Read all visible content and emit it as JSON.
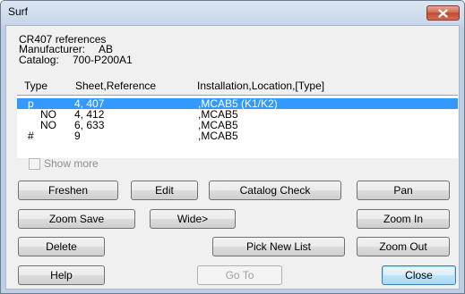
{
  "window": {
    "title": "Surf"
  },
  "info": {
    "references": "CR407 references",
    "manufacturer_label": "Manufacturer:",
    "manufacturer_value": "AB",
    "catalog_label": "Catalog:",
    "catalog_value": "700-P200A1"
  },
  "list": {
    "columns": [
      "Type",
      "Sheet,Reference",
      "Installation,Location,[Type]"
    ],
    "rows": [
      {
        "type": "p",
        "ref": "4, 407",
        "loc": ",MCAB5 (K1/K2)",
        "selected": true
      },
      {
        "type": "NO",
        "ref": "4, 412",
        "loc": ",MCAB5",
        "selected": false
      },
      {
        "type": "NO",
        "ref": "6, 633",
        "loc": ",MCAB5",
        "selected": false
      },
      {
        "type": "#",
        "ref": "9",
        "loc": ",MCAB5",
        "selected": false
      }
    ]
  },
  "show_more": {
    "label": "Show more",
    "checked": false,
    "enabled": false
  },
  "buttons": {
    "freshen": "Freshen",
    "edit": "Edit",
    "catalog_check": "Catalog Check",
    "pan": "Pan",
    "zoom_save": "Zoom Save",
    "wide": "Wide>",
    "zoom_in": "Zoom In",
    "delete": "Delete",
    "pick_new_list": "Pick New List",
    "zoom_out": "Zoom Out",
    "help": "Help",
    "go_to": "Go To",
    "close": "Close"
  },
  "colors": {
    "selection": "#3399ff",
    "close_button": "#c44a33"
  }
}
